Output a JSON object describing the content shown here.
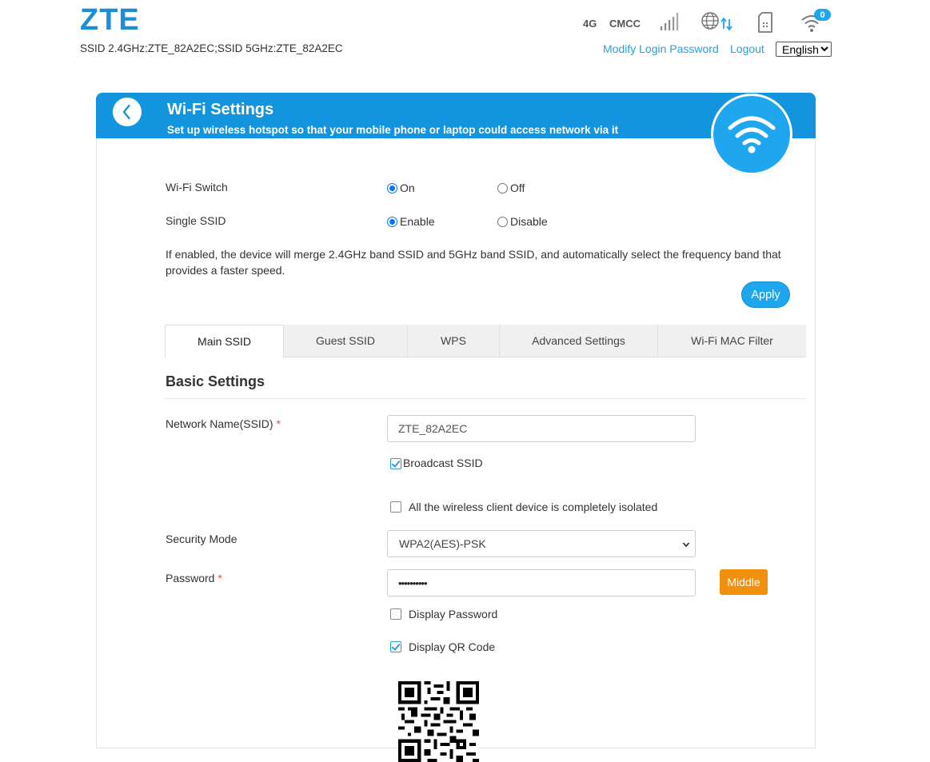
{
  "header": {
    "logo": "ZTE",
    "ssid_line": "SSID 2.4GHz:ZTE_82A2EC;SSID 5GHz:ZTE_82A2EC",
    "network_type": "4G",
    "carrier": "CMCC",
    "wifi_clients_count": "0",
    "modify_password_link": "Modify Login Password",
    "logout_link": "Logout",
    "language": "English"
  },
  "page": {
    "title": "Wi-Fi Settings",
    "subtitle": "Set up wireless hotspot so that your mobile phone or laptop could access network via it"
  },
  "wifi_switch": {
    "label": "Wi-Fi Switch",
    "on_label": "On",
    "off_label": "Off",
    "value": "On"
  },
  "single_ssid": {
    "label": "Single SSID",
    "enable_label": "Enable",
    "disable_label": "Disable",
    "value": "Enable"
  },
  "description": "If enabled, the device will merge 2.4GHz band SSID and 5GHz band SSID, and automatically select the frequency band that provides a faster speed.",
  "apply_label": "Apply",
  "tabs": [
    {
      "label": "Main SSID",
      "active": true
    },
    {
      "label": "Guest SSID",
      "active": false
    },
    {
      "label": "WPS",
      "active": false
    },
    {
      "label": "Advanced Settings",
      "active": false
    },
    {
      "label": "Wi-Fi MAC Filter",
      "active": false
    }
  ],
  "basic_settings": {
    "title": "Basic Settings",
    "network_name_label": "Network Name(SSID)",
    "required_mark": "*",
    "network_name_value": "ZTE_82A2EC",
    "broadcast_ssid_label": "Broadcast SSID",
    "broadcast_ssid_checked": true,
    "isolation_label": "All the wireless client device is completely isolated",
    "isolation_checked": false,
    "security_mode_label": "Security Mode",
    "security_mode_value": "WPA2(AES)-PSK",
    "password_label": "Password",
    "password_value": "••••••••••",
    "password_strength": "Middle",
    "display_password_label": "Display Password",
    "display_password_checked": false,
    "display_qr_label": "Display QR Code",
    "display_qr_checked": true
  },
  "colors": {
    "brand_blue": "#1294de",
    "accent_blue": "#1ea7ef",
    "link_blue": "#2a9fd6",
    "strength_orange": "#f0900d"
  },
  "icons": [
    "signal-bars-icon",
    "globe-transfer-icon",
    "sim-card-icon",
    "wifi-icon",
    "back-chevron-icon",
    "wifi-large-icon",
    "chevron-down-icon",
    "qr-code-image"
  ]
}
